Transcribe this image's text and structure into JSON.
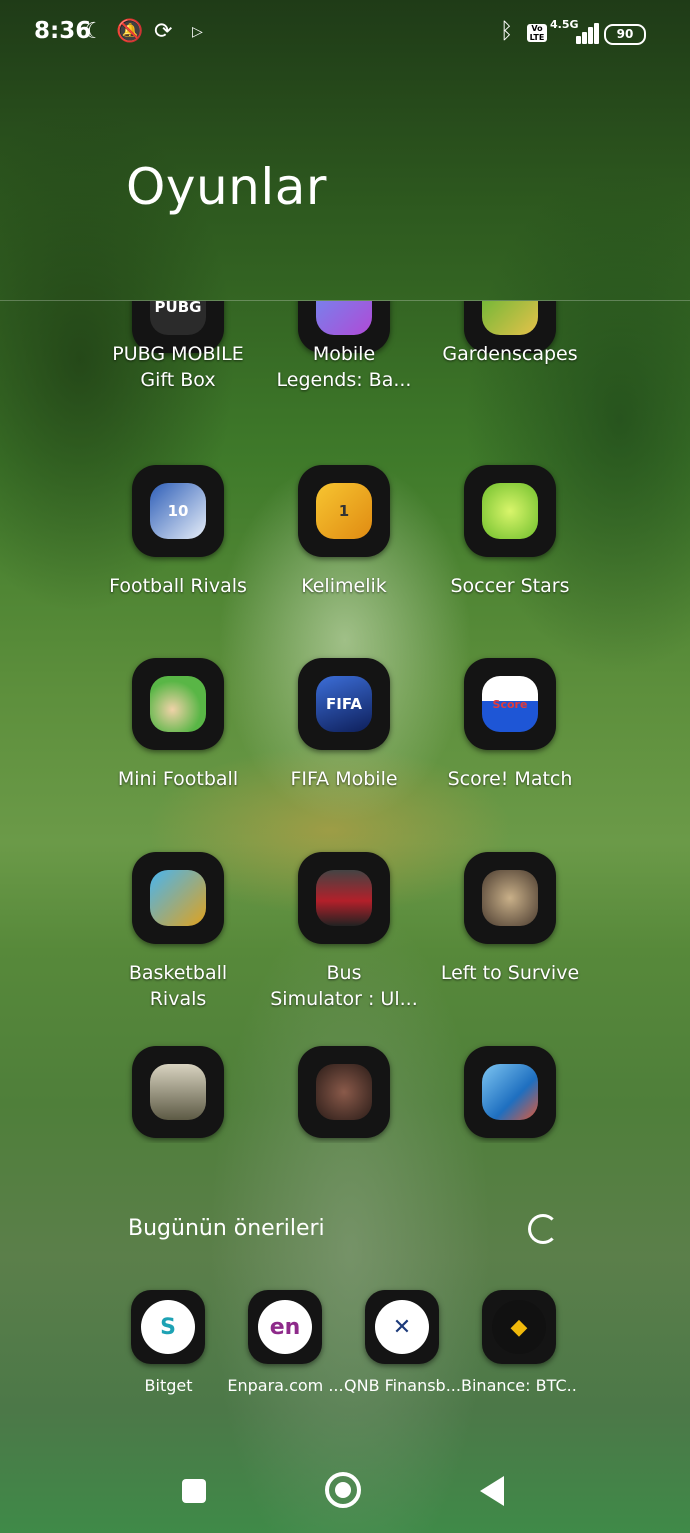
{
  "status_bar": {
    "time": "8:36",
    "network": "4.5G",
    "volte": "Vo LTE",
    "battery": "90",
    "icons": [
      "moon-icon",
      "mute-bell-icon",
      "sync-icon",
      "play-icon",
      "bluetooth-icon",
      "signal-icon",
      "battery-icon"
    ]
  },
  "folder": {
    "title": "Oyunlar",
    "apps": [
      {
        "label": "PUBG MOBILE\nGift Box",
        "icon": "pubg-icon",
        "color": "#2b2b2b"
      },
      {
        "label": "Mobile\nLegends: Ba...",
        "icon": "mobile-legends-icon",
        "color": "#4b6bd6"
      },
      {
        "label": "Gardenscapes",
        "icon": "gardenscapes-icon",
        "color": "#5bb534"
      },
      {
        "label": "Football Rivals",
        "icon": "football-rivals-icon",
        "color": "#2f5fb8"
      },
      {
        "label": "Kelimelik",
        "icon": "kelimelik-icon",
        "color": "#f2b21b"
      },
      {
        "label": "Soccer Stars",
        "icon": "soccer-stars-icon",
        "color": "#8fd43a"
      },
      {
        "label": "Mini Football",
        "icon": "mini-football-icon",
        "color": "#59b646"
      },
      {
        "label": "FIFA Mobile",
        "icon": "fifa-mobile-icon",
        "color": "#1e3a8a"
      },
      {
        "label": "Score! Match",
        "icon": "score-match-icon",
        "color": "#e23b3b"
      },
      {
        "label": "Basketball\nRivals",
        "icon": "basketball-rivals-icon",
        "color": "#2a8ad4"
      },
      {
        "label": "Bus\nSimulator : Ul...",
        "icon": "bus-simulator-icon",
        "color": "#b3202a"
      },
      {
        "label": "Left to Survive",
        "icon": "left-to-survive-icon",
        "color": "#6b5a4a"
      },
      {
        "label": "",
        "icon": "soldier-game-icon",
        "color": "#7a7560"
      },
      {
        "label": "",
        "icon": "shooter-game-icon",
        "color": "#5a3a32"
      },
      {
        "label": "",
        "icon": "sports-game-icon",
        "color": "#3a8fd0"
      }
    ]
  },
  "suggestions": {
    "title": "Bugünün önerileri",
    "items": [
      {
        "label": "Bitget",
        "icon": "bitget-icon",
        "color": "#1f2b3a",
        "glyph": "S"
      },
      {
        "label": "Enpara.com ...",
        "icon": "enpara-icon",
        "color": "#8e2a8a",
        "glyph": "en"
      },
      {
        "label": "QNB Finansb...",
        "icon": "qnb-icon",
        "color": "#1c3a7a",
        "glyph": "✕"
      },
      {
        "label": "Binance: BTC...",
        "icon": "binance-icon",
        "color": "#111111",
        "glyph": "◆"
      }
    ]
  },
  "nav": {
    "icons": [
      "recents-icon",
      "home-icon",
      "back-icon"
    ]
  }
}
